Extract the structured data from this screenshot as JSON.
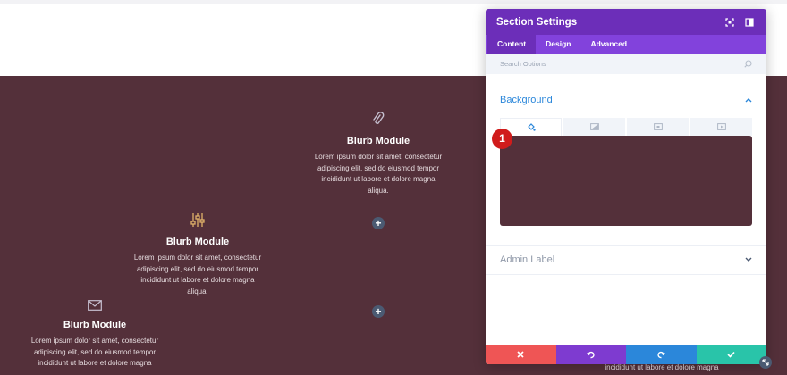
{
  "blurbs": [
    {
      "title": "Blurb Module",
      "icon": "paperclip-icon",
      "line1": "Lorem ipsum dolor sit amet, consectetur",
      "line2": "adipiscing elit, sed do eiusmod tempor",
      "line3": "incididunt ut labore et dolore magna",
      "line4": "aliqua."
    },
    {
      "title": "Blurb Module",
      "icon": "sliders-icon",
      "line1": "Lorem ipsum dolor sit amet, consectetur",
      "line2": "adipiscing elit, sed do eiusmod tempor",
      "line3": "incididunt ut labore et dolore magna",
      "line4": "aliqua."
    },
    {
      "title": "Blurb Module",
      "icon": "envelope-icon",
      "line1": "Lorem ipsum dolor sit amet, consectetur",
      "line2": "adipiscing elit, sed do eiusmod tempor",
      "line3": "incididunt ut labore et dolore magna"
    }
  ],
  "add_module_label": "+",
  "stray_text": "incididunt ut labore et dolore magna",
  "panel": {
    "title": "Section Settings",
    "tabs": [
      "Content",
      "Design",
      "Advanced"
    ],
    "active_tab": "Content",
    "search_placeholder": "Search Options",
    "background_title": "Background",
    "background_color": "#54303a",
    "marker_number": "1",
    "admin_label": "Admin Label"
  },
  "colors": {
    "section_bg": "#54303a",
    "panel_header": "#6c2eb9",
    "panel_tabs": "#8242dc",
    "accent_blue": "#2b87da",
    "cancel": "#ef5555",
    "undo": "#7e3bd0",
    "redo": "#2b87da",
    "save": "#29c4a9"
  }
}
